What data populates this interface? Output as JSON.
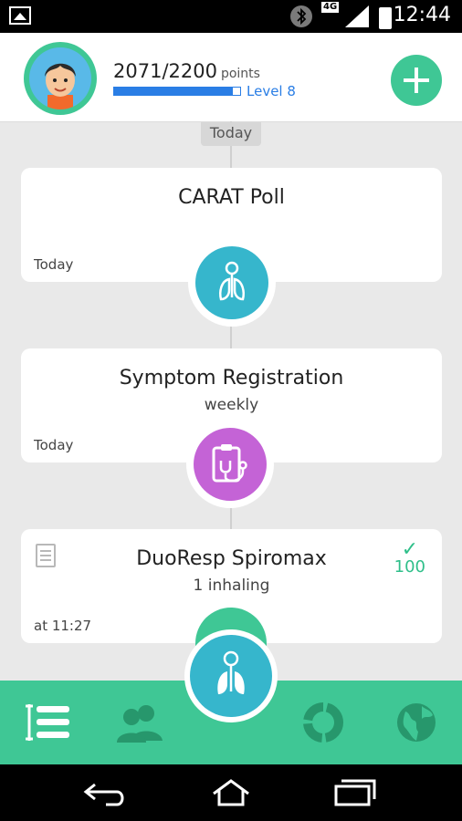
{
  "status_bar": {
    "time": "12:44",
    "network": "4G",
    "icons": [
      "image-icon",
      "bluetooth-icon",
      "signal-icon",
      "battery-icon"
    ]
  },
  "header": {
    "points": "2071/2200",
    "points_unit": "points",
    "progress_fraction": 0.94,
    "level": "Level 8",
    "add_icon": "plus-icon"
  },
  "timeline": {
    "day_chip": "Today",
    "cards": [
      {
        "title": "CARAT Poll",
        "subtitle": "",
        "date": "Today",
        "icon": "lungs-icon",
        "icon_color": "#36b6cc"
      },
      {
        "title": "Symptom Registration",
        "subtitle": "weekly",
        "date": "Today",
        "icon": "clipboard-stethoscope-icon",
        "icon_color": "#c463d6"
      },
      {
        "title": "DuoResp Spiromax",
        "subtitle": "1 inhaling",
        "date": "at 11:27",
        "icon": "inhaler-icon",
        "icon_color": "#3fc795",
        "score": "100"
      }
    ]
  },
  "bottom_nav": {
    "items": [
      "list-icon",
      "people-icon",
      "lungs-icon",
      "chart-ring-icon",
      "globe-icon"
    ],
    "active": "list-icon",
    "color": "#3fc795"
  },
  "system_nav": [
    "back-icon",
    "home-icon",
    "recents-icon"
  ],
  "colors": {
    "accent": "#3fc795",
    "blue": "#2a7ee5",
    "teal": "#36b6cc",
    "purple": "#c463d6"
  }
}
